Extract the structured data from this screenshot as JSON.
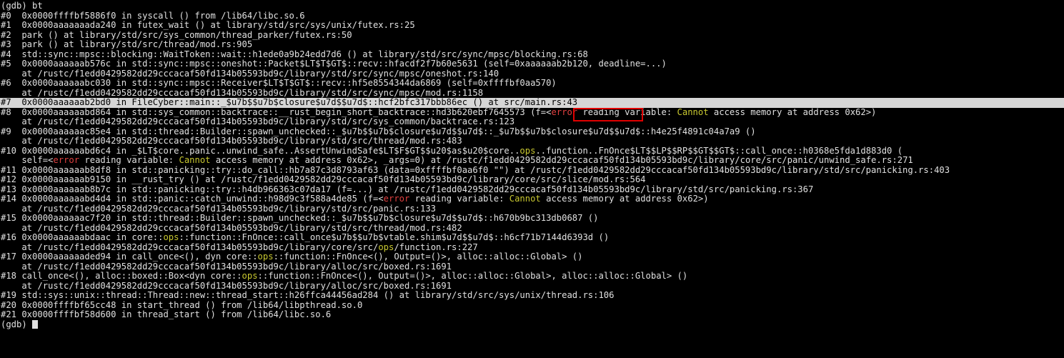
{
  "lines": [
    [
      {
        "t": "(gdb) bt"
      }
    ],
    [
      {
        "t": "#0  0x0000ffffbf5886f0 in syscall () from /lib64/libc.so.6"
      }
    ],
    [
      {
        "t": "#1  0x0000aaaaaaada240 in futex_wait () at library/std/src/sys/unix/futex.rs:25"
      }
    ],
    [
      {
        "t": "#2  park () at library/std/src/sys_common/thread_parker/futex.rs:50"
      }
    ],
    [
      {
        "t": "#3  park () at library/std/src/thread/mod.rs:905"
      }
    ],
    [
      {
        "t": "#4  std::sync::mpsc::blocking::WaitToken::wait::h1ede0a9b24edd7d6 () at library/std/src/sync/mpsc/blocking.rs:68"
      }
    ],
    [
      {
        "t": "#5  0x0000aaaaaab576c in std::sync::mpsc::oneshot::Packet$LT$T$GT$::recv::hfacdf2f7b60e5631 (self=0xaaaaaab2b120, deadline=...)"
      }
    ],
    [
      {
        "t": "    at /rustc/f1edd0429582dd29cccacaf50fd134b05593bd9c/library/std/src/sync/mpsc/oneshot.rs:140"
      }
    ],
    [
      {
        "t": "#6  0x0000aaaaaabc030 in std::sync::mpsc::Receiver$LT$T$GT$::recv::hf5e8554344da6869 (self=0xffffbf0aa570)"
      }
    ],
    [
      {
        "t": "    at /rustc/f1edd0429582dd29cccacaf50fd134b05593bd9c/library/std/src/sync/mpsc/mod.rs:1158"
      }
    ],
    [
      {
        "t": "#7  0x0000aaaaaab2bd0 in FileCyber::main::_$u7b$$u7b$closure$u7d$$u7d$::hcf2bfc317bbb86ec () at src/main.rs:43"
      }
    ],
    [
      {
        "t": "#8  0x0000aaaaaabd864 in std::sys_common::backtrace::__rust_begin_short_backtrace::hd3b620ebf7645573 (f=<"
      },
      {
        "t": "error",
        "c": "err"
      },
      {
        "t": " reading variable: "
      },
      {
        "t": "Cannot",
        "c": "warn"
      },
      {
        "t": " access memory at address 0x62>)"
      }
    ],
    [
      {
        "t": "    at /rustc/f1edd0429582dd29cccacaf50fd134b05593bd9c/library/std/src/sys_common/backtrace.rs:123"
      }
    ],
    [
      {
        "t": "#9  0x0000aaaaaac85e4 in std::thread::Builder::spawn_unchecked::_$u7b$$u7b$closure$u7d$$u7d$::_$u7b$$u7b$closure$u7d$$u7d$::h4e25f4891c04a7a9 ()"
      }
    ],
    [
      {
        "t": "    at /rustc/f1edd0429582dd29cccacaf50fd134b05593bd9c/library/std/src/thread/mod.rs:483"
      }
    ],
    [
      {
        "t": "#10 0x0000aaaaaabd6c4 in _$LT$core..panic..unwind_safe..AssertUnwindSafe$LT$F$GT$$u20$as$u20$core.."
      },
      {
        "t": "ops",
        "c": "warn"
      },
      {
        "t": "..function..FnOnce$LT$$LP$$RP$$GT$$GT$::call_once::h0368e5fda1d883d0 ("
      }
    ],
    [
      {
        "t": "    self=<"
      },
      {
        "t": "error",
        "c": "err"
      },
      {
        "t": " reading variable: "
      },
      {
        "t": "Cannot",
        "c": "warn"
      },
      {
        "t": " access memory at address 0x62>, _args=0) at /rustc/f1edd0429582dd29cccacaf50fd134b05593bd9c/library/core/src/panic/unwind_safe.rs:271"
      }
    ],
    [
      {
        "t": "#11 0x0000aaaaaab8df8 in std::panicking::try::do_call::hb7a87c3d8793af63 (data=0xffffbf0aa6f0 \"\") at /rustc/f1edd0429582dd29cccacaf50fd134b05593bd9c/library/std/src/panicking.rs:403"
      }
    ],
    [
      {
        "t": "#12 0x0000aaaaaab9150 in __rust_try () at /rustc/f1edd0429582dd29cccacaf50fd134b05593bd9c/library/core/src/slice/mod.rs:564"
      }
    ],
    [
      {
        "t": "#13 0x0000aaaaaab8b7c in std::panicking::try::h4db966363c07da17 (f=...) at /rustc/f1edd0429582dd29cccacaf50fd134b05593bd9c/library/std/src/panicking.rs:367"
      }
    ],
    [
      {
        "t": "#14 0x0000aaaaaabd4d4 in std::panic::catch_unwind::h98d9c3f588a4de85 (f=<"
      },
      {
        "t": "error",
        "c": "err"
      },
      {
        "t": " reading variable: "
      },
      {
        "t": "Cannot",
        "c": "warn"
      },
      {
        "t": " access memory at address 0x62>)"
      }
    ],
    [
      {
        "t": "    at /rustc/f1edd0429582dd29cccacaf50fd134b05593bd9c/library/std/src/panic.rs:133"
      }
    ],
    [
      {
        "t": "#15 0x0000aaaaaac7f20 in std::thread::Builder::spawn_unchecked::_$u7b$$u7b$closure$u7d$$u7d$::h670b9bc313db0687 ()"
      }
    ],
    [
      {
        "t": "    at /rustc/f1edd0429582dd29cccacaf50fd134b05593bd9c/library/std/src/thread/mod.rs:482"
      }
    ],
    [
      {
        "t": "#16 0x0000aaaaaabdaac in core::"
      },
      {
        "t": "ops",
        "c": "warn"
      },
      {
        "t": "::function::FnOnce::call_once$u7b$$u7b$vtable.shim$u7d$$u7d$::h6cf71b7144d6393d ()"
      }
    ],
    [
      {
        "t": "    at /rustc/f1edd0429582dd29cccacaf50fd134b05593bd9c/library/core/src/"
      },
      {
        "t": "ops",
        "c": "warn"
      },
      {
        "t": "/function.rs:227"
      }
    ],
    [
      {
        "t": "#17 0x0000aaaaaaded94 in call_once<(), dyn core::"
      },
      {
        "t": "ops",
        "c": "warn"
      },
      {
        "t": "::function::FnOnce<(), Output=()>, alloc::alloc::Global> ()"
      }
    ],
    [
      {
        "t": "    at /rustc/f1edd0429582dd29cccacaf50fd134b05593bd9c/library/alloc/src/boxed.rs:1691"
      }
    ],
    [
      {
        "t": "#18 call_once<(), alloc::boxed::Box<dyn core::"
      },
      {
        "t": "ops",
        "c": "warn"
      },
      {
        "t": "::function::FnOnce<(), Output=()>, alloc::alloc::Global>, alloc::alloc::Global> ()"
      }
    ],
    [
      {
        "t": "    at /rustc/f1edd0429582dd29cccacaf50fd134b05593bd9c/library/alloc/src/boxed.rs:1691"
      }
    ],
    [
      {
        "t": "#19 std::sys::unix::thread::Thread::new::thread_start::h26ffca44456ad284 () at library/std/src/sys/unix/thread.rs:106"
      }
    ],
    [
      {
        "t": "#20 0x0000ffffbf65cc48 in start_thread () from /lib64/libpthread.so.0"
      }
    ],
    [
      {
        "t": "#21 0x0000ffffbf58d600 in thread_start () from /lib64/libc.so.6"
      }
    ],
    [
      {
        "t": "(gdb) "
      }
    ]
  ],
  "highlighted_line": 10,
  "annotation_box_label": "main.rs:43",
  "colors": {
    "background": "#000000",
    "text": "#e0e0e0",
    "error": "#e04040",
    "warning": "#c8c830",
    "highlight": "#d6d6d6",
    "box": "#e00000"
  },
  "prompt": {
    "cursor": "block-cursor"
  }
}
